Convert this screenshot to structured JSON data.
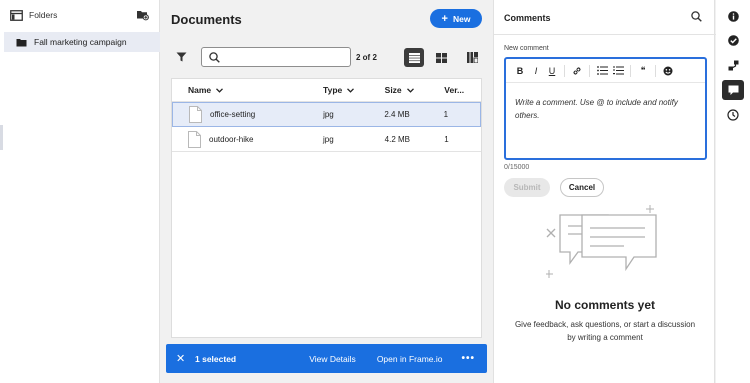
{
  "folders": {
    "title": "Folders",
    "items": [
      {
        "label": "Fall marketing campaign"
      }
    ]
  },
  "documents": {
    "title": "Documents",
    "new_label": "New",
    "search": {
      "placeholder": "",
      "value": ""
    },
    "count": "2 of 2",
    "columns": [
      "Name",
      "Type",
      "Size",
      "Ver..."
    ],
    "rows": [
      {
        "name": "office-setting",
        "type": "jpg",
        "size": "2.4 MB",
        "version": "1",
        "selected": true
      },
      {
        "name": "outdoor-hike",
        "type": "jpg",
        "size": "4.2 MB",
        "version": "1",
        "selected": false
      }
    ],
    "selection_bar": {
      "count_label": "1 selected",
      "view_details": "View Details",
      "open_in": "Open in Frame.io",
      "more": "•••"
    }
  },
  "comments": {
    "title": "Comments",
    "new_comment_label": "New comment",
    "toolbar": {
      "bold": "B",
      "italic": "I",
      "underline": "U",
      "quote": "❝"
    },
    "placeholder": "Write a comment. Use @ to include and notify others.",
    "char_count": "0/15000",
    "submit_label": "Submit",
    "cancel_label": "Cancel",
    "empty_title": "No comments yet",
    "empty_desc": "Give feedback, ask questions, or start a discussion by writing a comment"
  },
  "rail": {
    "icons": [
      "info-icon",
      "checkmark-circle-icon",
      "workflow-icon",
      "comment-icon",
      "history-icon"
    ],
    "active": "comment-icon"
  },
  "colors": {
    "accent": "#1a6fe0",
    "selected_row": "#e6ecf8",
    "active_view": "#3c3c3c"
  }
}
